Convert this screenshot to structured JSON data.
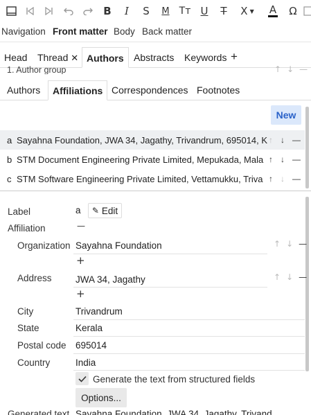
{
  "toolbar": {
    "icons": [
      "sidebar-icon",
      "first-icon",
      "last-icon",
      "undo-icon",
      "redo-icon",
      "bold-icon",
      "italic-icon",
      "strike-s-icon",
      "math-icon",
      "small-caps-icon",
      "underline-icon",
      "strikethrough-icon",
      "clear-format-icon",
      "text-color-icon",
      "special-char-icon"
    ],
    "bold": "B",
    "italic": "I",
    "strike_s": "S",
    "math": "M",
    "small_caps": "Tт",
    "underline": "U",
    "strike": "T",
    "clear": "X",
    "text_color": "A",
    "omega": "Ω"
  },
  "nav": {
    "tabs": [
      "Navigation",
      "Front matter",
      "Body",
      "Back matter"
    ],
    "active": "Front matter"
  },
  "tabs2": {
    "items": [
      "Head",
      "Thread",
      "Authors",
      "Abstracts",
      "Keywords"
    ],
    "active": "Authors",
    "add": "+"
  },
  "group": {
    "title": "1. Author group"
  },
  "tabs3": {
    "items": [
      "Authors",
      "Affiliations",
      "Correspondences",
      "Footnotes"
    ],
    "active": "Affiliations"
  },
  "list": {
    "new_label": "New",
    "rows": [
      {
        "key": "a",
        "text": "Sayahna Foundation, JWA 34, Jagathy, Trivandrum, 695014, K"
      },
      {
        "key": "b",
        "text": "STM Document Engineering Private Limited, Mepukada, Mala"
      },
      {
        "key": "c",
        "text": "STM Software Engineering Private Limited, Vettamukku, Triva"
      }
    ]
  },
  "detail": {
    "label_caption": "Label",
    "label_value": "a",
    "edit_label": "Edit",
    "affiliation_caption": "Affiliation",
    "organization_caption": "Organization",
    "organization_value": "Sayahna Foundation",
    "address_caption": "Address",
    "address_value": "JWA 34, Jagathy",
    "city_caption": "City",
    "city_value": "Trivandrum",
    "state_caption": "State",
    "state_value": "Kerala",
    "postal_caption": "Postal code",
    "postal_value": "695014",
    "country_caption": "Country",
    "country_value": "India",
    "generate_label": "Generate the text from structured fields",
    "options_label": "Options...",
    "generated_caption": "Generated text",
    "generated_value": "Sayahna Foundation, JWA 34, Jagathy, Trivand"
  },
  "colors": {
    "accent": "#2a62c9",
    "new_bg": "#dbe8fb",
    "selected_row": "#eef0f2"
  }
}
